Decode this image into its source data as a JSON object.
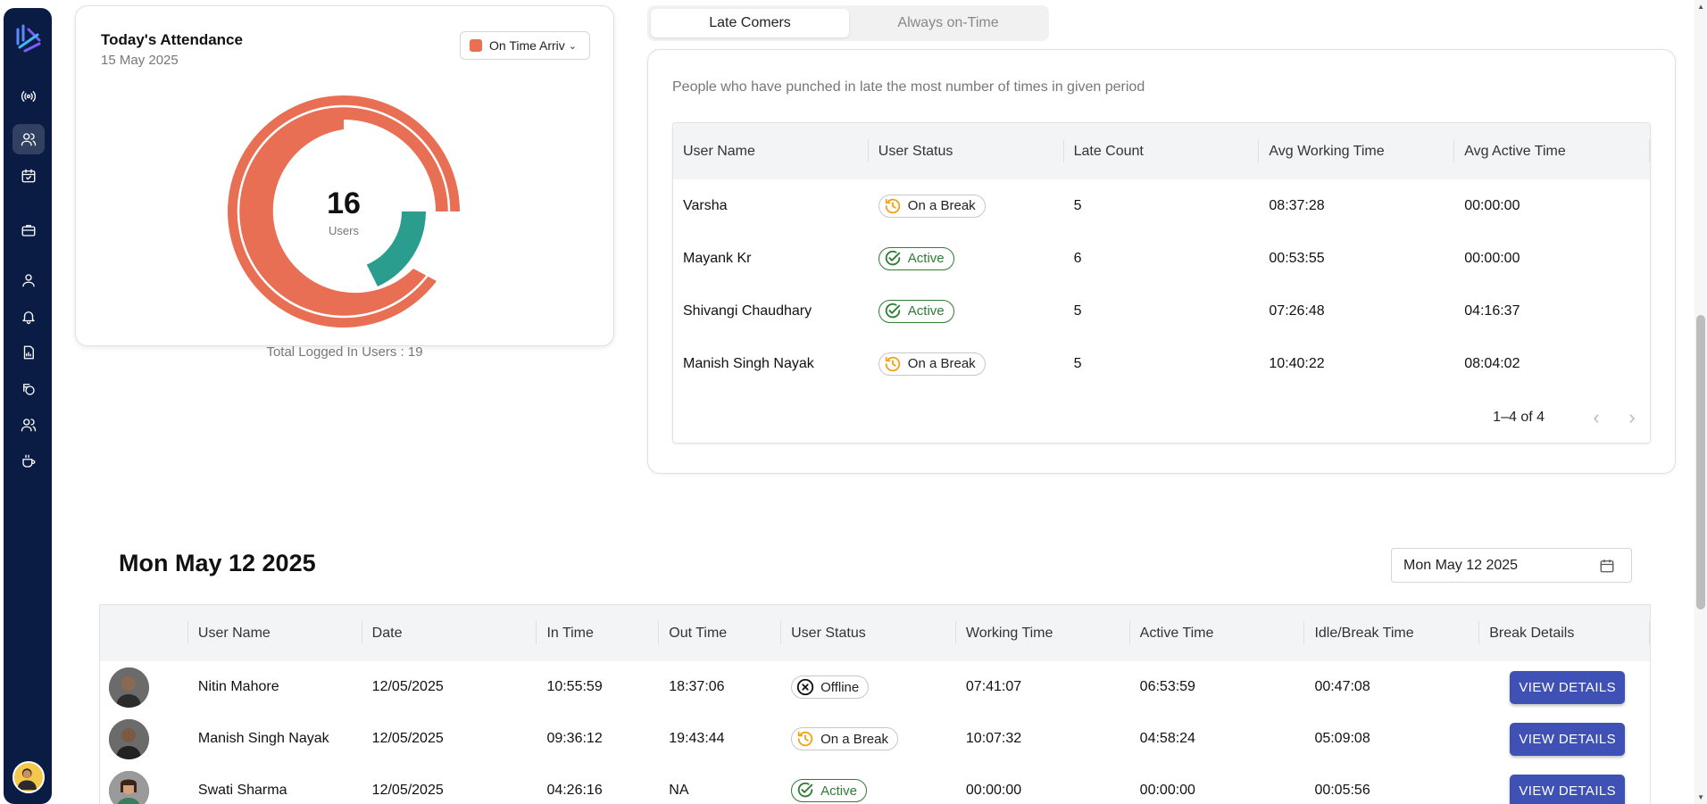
{
  "attendance": {
    "title": "Today's Attendance",
    "date": "15 May 2025",
    "filter_value": "On Time Arriv",
    "center_value": "16",
    "center_label": "Users",
    "total_logged": "Total Logged In Users : 19",
    "colors": {
      "on_time": "#e86f53",
      "other": "#2a9d8f"
    }
  },
  "tabs": [
    {
      "label": "Late Comers",
      "active": true
    },
    {
      "label": "Always on-Time",
      "active": false
    }
  ],
  "late": {
    "description": "People who have punched in late the most number of times in given period",
    "columns": [
      "User Name",
      "User Status",
      "Late Count",
      "Avg Working Time",
      "Avg Active Time"
    ],
    "rows": [
      {
        "name": "Varsha",
        "status": "On a Break",
        "late_count": "5",
        "avg_working": "08:37:28",
        "avg_active": "00:00:00"
      },
      {
        "name": "Mayank Kr",
        "status": "Active",
        "late_count": "6",
        "avg_working": "00:53:55",
        "avg_active": "00:00:00"
      },
      {
        "name": "Shivangi Chaudhary",
        "status": "Active",
        "late_count": "5",
        "avg_working": "07:26:48",
        "avg_active": "04:16:37"
      },
      {
        "name": "Manish Singh Nayak",
        "status": "On a Break",
        "late_count": "5",
        "avg_working": "10:40:22",
        "avg_active": "08:04:02"
      }
    ],
    "pagination": "1–4 of 4"
  },
  "day": {
    "title": "Mon May 12 2025",
    "picker_value": "Mon May 12 2025"
  },
  "details": {
    "columns": [
      "",
      "User Name",
      "Date",
      "In Time",
      "Out Time",
      "User Status",
      "Working Time",
      "Active Time",
      "Idle/Break Time",
      "Break Details"
    ],
    "rows": [
      {
        "name": "Nitin Mahore",
        "date": "12/05/2025",
        "in": "10:55:59",
        "out": "18:37:06",
        "status": "Offline",
        "working": "07:41:07",
        "active": "06:53:59",
        "idle": "00:47:08",
        "action": "VIEW DETAILS"
      },
      {
        "name": "Manish Singh Nayak",
        "date": "12/05/2025",
        "in": "09:36:12",
        "out": "19:43:44",
        "status": "On a Break",
        "working": "10:07:32",
        "active": "04:58:24",
        "idle": "05:09:08",
        "action": "VIEW DETAILS"
      },
      {
        "name": "Swati Sharma",
        "date": "12/05/2025",
        "in": "04:26:16",
        "out": "NA",
        "status": "Active",
        "working": "00:00:00",
        "active": "00:00:00",
        "idle": "00:05:56",
        "action": "VIEW DETAILS"
      }
    ]
  },
  "sidebar": {
    "icons": [
      "logo-icon",
      "broadcast-icon",
      "users-icon",
      "calendar-icon",
      "briefcase-icon",
      "user-icon",
      "bell-icon",
      "report-icon",
      "money-icon",
      "team-icon",
      "coffee-icon"
    ]
  }
}
